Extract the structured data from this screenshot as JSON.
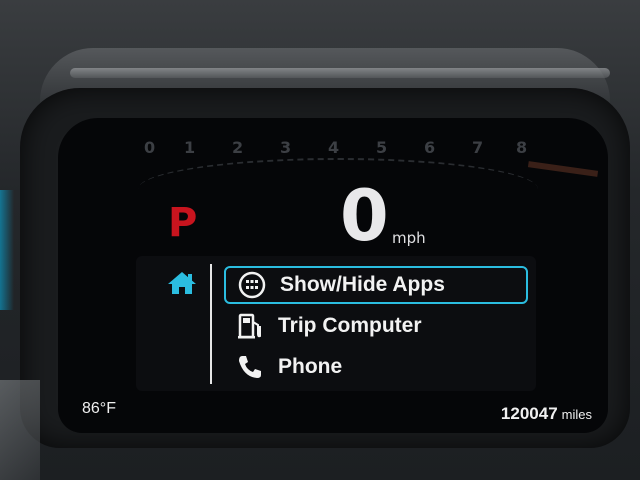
{
  "gauge": {
    "tick_labels": [
      "0",
      "1",
      "2",
      "3",
      "4",
      "5",
      "6",
      "7",
      "8"
    ]
  },
  "gear": "P",
  "speed": {
    "value": "0",
    "unit": "mph"
  },
  "menu": {
    "home_icon": "home-icon",
    "items": [
      {
        "label": "Show/Hide Apps",
        "icon": "apps-grid-icon",
        "selected": true
      },
      {
        "label": "Trip Computer",
        "icon": "fuel-pump-icon",
        "selected": false
      },
      {
        "label": "Phone",
        "icon": "phone-icon",
        "selected": false
      }
    ]
  },
  "status": {
    "temperature": "86",
    "temperature_unit": "°F",
    "odometer": "120047",
    "odometer_unit": "miles"
  },
  "colors": {
    "accent": "#2bbde0",
    "gear_red": "#c8141e"
  }
}
